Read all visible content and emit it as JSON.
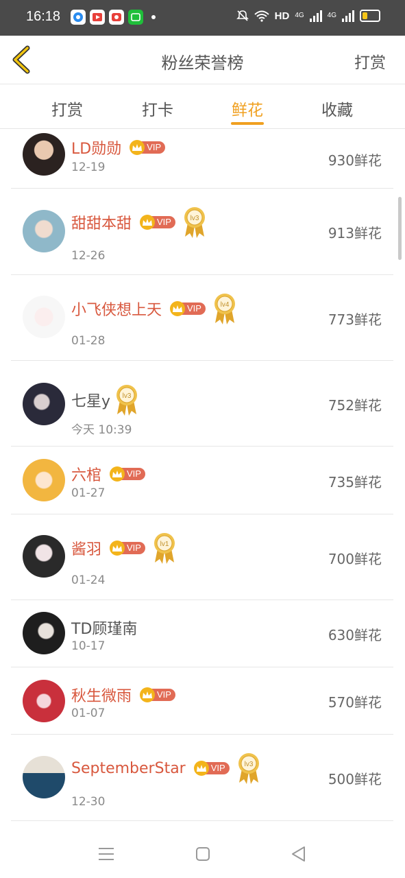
{
  "status": {
    "time": "16:18",
    "hd": "HD",
    "net1": "4G",
    "net2": "4G"
  },
  "nav": {
    "title": "粉丝荣誉榜",
    "action": "打赏"
  },
  "tabs": [
    {
      "label": "打赏"
    },
    {
      "label": "打卡"
    },
    {
      "label": "鲜花",
      "active": true
    },
    {
      "label": "收藏"
    }
  ],
  "vip_label": "VIP",
  "rows": [
    {
      "name": "LD勋勋",
      "date": "12-19",
      "amount": "930鲜花",
      "vip": true,
      "medal": ""
    },
    {
      "name": "甜甜本甜",
      "date": "12-26",
      "amount": "913鲜花",
      "vip": true,
      "medal": "lv3"
    },
    {
      "name": "小飞侠想上天",
      "date": "01-28",
      "amount": "773鲜花",
      "vip": true,
      "medal": "lv4"
    },
    {
      "name": "七星y",
      "date": "今天 10:39",
      "amount": "752鲜花",
      "vip": false,
      "medal": "lv3"
    },
    {
      "name": "六棺",
      "date": "01-27",
      "amount": "735鲜花",
      "vip": true,
      "medal": ""
    },
    {
      "name": "酱羽",
      "date": "01-24",
      "amount": "700鲜花",
      "vip": true,
      "medal": "lv1"
    },
    {
      "name": "TD顾瑾南",
      "date": "10-17",
      "amount": "630鲜花",
      "vip": false,
      "medal": ""
    },
    {
      "name": "秋生微雨",
      "date": "01-07",
      "amount": "570鲜花",
      "vip": true,
      "medal": ""
    },
    {
      "name": "SeptemberStar",
      "date": "12-30",
      "amount": "500鲜花",
      "vip": true,
      "medal": "lv3"
    }
  ],
  "colors": {
    "accent": "#f0a020",
    "vip_name": "#d8583e",
    "vip_pill": "#e16b55",
    "crown": "#f3b41b"
  }
}
